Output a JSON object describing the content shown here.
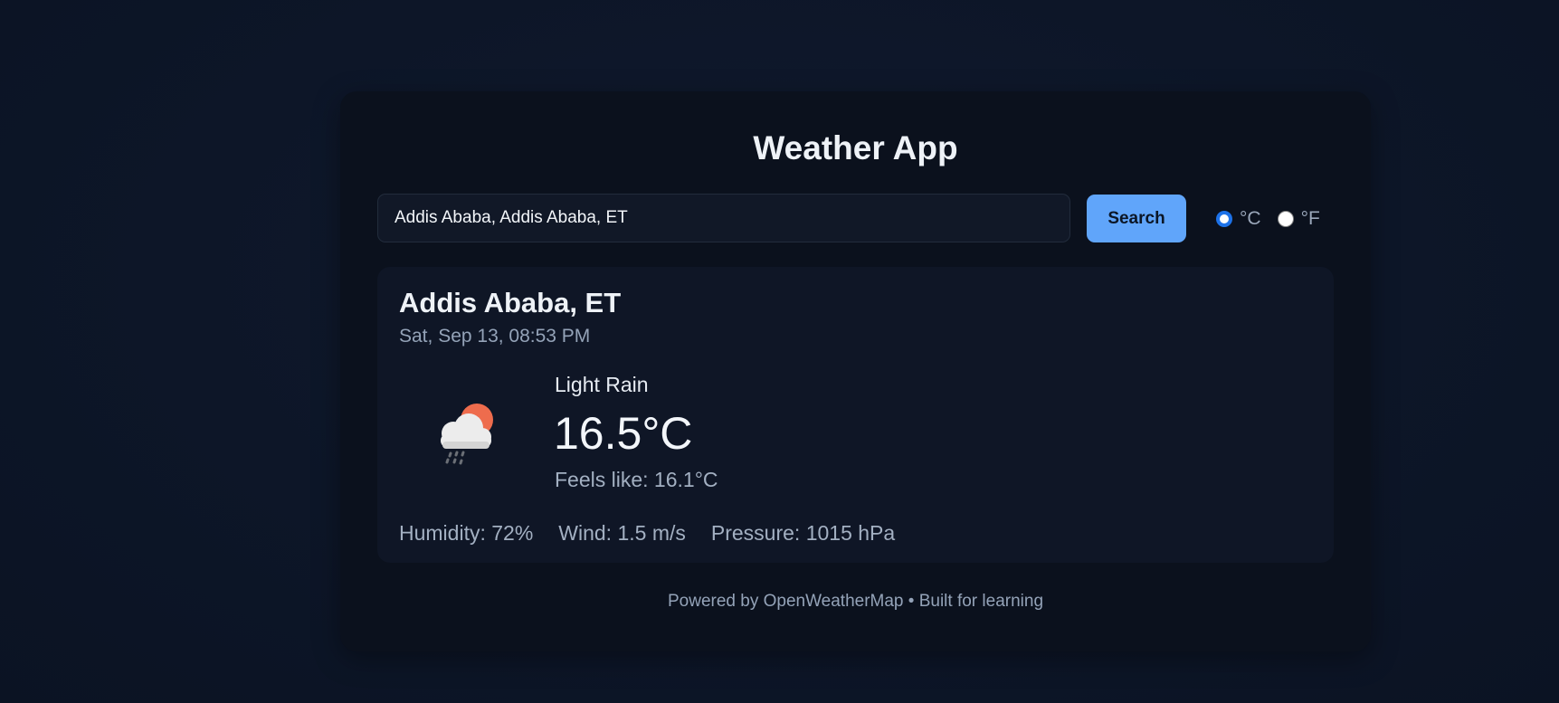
{
  "app": {
    "title": "Weather App"
  },
  "search": {
    "value": "Addis Ababa, Addis Ababa, ET",
    "button_label": "Search"
  },
  "units": {
    "celsius_label": "°C",
    "fahrenheit_label": "°F",
    "selected": "°C"
  },
  "weather": {
    "city": "Addis Ababa, ET",
    "datetime": "Sat, Sep 13, 08:53 PM",
    "condition": "Light Rain",
    "temperature": "16.5°C",
    "feels_like": "Feels like: 16.1°C",
    "humidity": "Humidity: 72%",
    "wind": "Wind: 1.5 m/s",
    "pressure": "Pressure: 1015 hPa",
    "icon": "cloud-sun-rain-icon"
  },
  "footer": {
    "text": "Powered by OpenWeatherMap • Built for learning"
  },
  "colors": {
    "accent": "#60a5fa",
    "background": "#0d1628",
    "card": "#0b111d",
    "panel": "#0f1626"
  }
}
